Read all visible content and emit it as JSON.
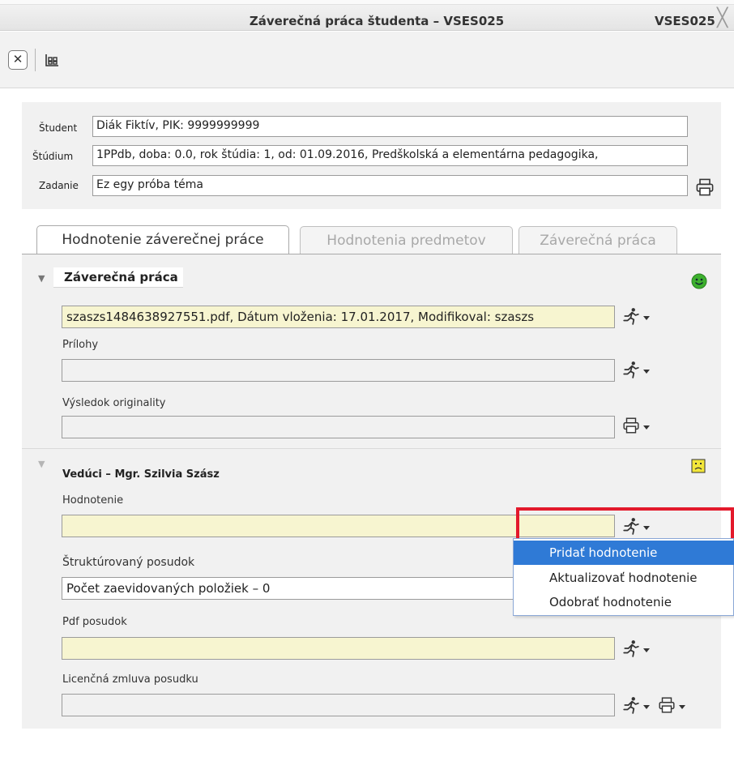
{
  "window": {
    "title": "Záverečná práca študenta – VSES025",
    "code": "VSES025"
  },
  "toolbar": {
    "close_symbol": "✕"
  },
  "info": {
    "student_label": "Študent",
    "student_value": "Diák Fiktív, PIK: 9999999999",
    "study_label": "Štúdium",
    "study_value": "1PPdb, doba: 0.0, rok štúdia: 1, od: 01.09.2016, Predškolská a elementárna pedagogika,",
    "assignment_label": "Zadanie",
    "assignment_value": "Ez egy próba téma"
  },
  "tabs": [
    {
      "label": "Hodnotenie záverečnej práce",
      "active": true
    },
    {
      "label": "Hodnotenia predmetov",
      "active": false
    },
    {
      "label": "Záverečná práca",
      "active": false
    }
  ],
  "section_thesis": {
    "title": "Záverečná práca",
    "file_value": "szaszs1484638927551.pdf, Dátum vloženia: 17.01.2017, Modifikoval: szaszs",
    "attachments_label": "Prílohy",
    "originality_label": "Výsledok originality",
    "status_icon": "smiley-green-icon"
  },
  "section_supervisor": {
    "title": "Vedúci – Mgr. Szilvia Szász",
    "evaluation_label": "Hodnotenie",
    "structured_label": "Štruktúrovaný posudok",
    "structured_value": "Počet zaevidovaných položiek – 0",
    "pdf_label": "Pdf posudok",
    "license_label": "Licenčná zmluva posudku",
    "status_icon": "sad-face-icon"
  },
  "dropdown": {
    "items": [
      "Pridať hodnotenie",
      "Aktualizovať hodnotenie",
      "Odobrať hodnotenie"
    ],
    "highlighted": "Pridať hodnotenie"
  },
  "colors": {
    "highlight": "#2f7ad6",
    "emphasis_box": "#e3192b",
    "yellow_field": "#f7f5d0",
    "status_ok": "#3db02e"
  }
}
